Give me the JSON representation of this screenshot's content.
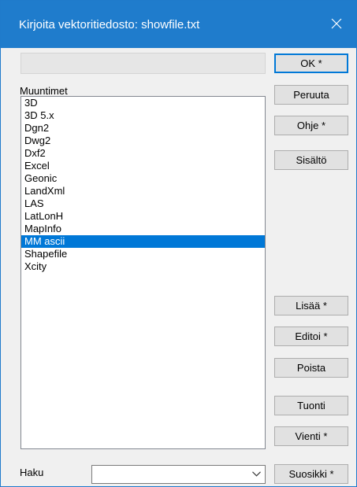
{
  "window": {
    "title": "Kirjoita vektoritiedosto: showfile.txt"
  },
  "file_field": {
    "value": ""
  },
  "converters": {
    "label": "Muuntimet",
    "items": [
      "3D",
      "3D 5.x",
      "Dgn2",
      "Dwg2",
      "Dxf2",
      "Excel",
      "Geonic",
      "LandXml",
      "LAS",
      "LatLonH",
      "MapInfo",
      "MM ascii",
      "Shapefile",
      "Xcity"
    ],
    "selected": "MM ascii"
  },
  "buttons": {
    "ok": "OK *",
    "cancel": "Peruuta",
    "help": "Ohje *",
    "contents": "Sisältö",
    "add": "Lisää *",
    "edit": "Editoi *",
    "delete": "Poista",
    "import": "Tuonti",
    "export": "Vienti *",
    "favorite": "Suosikki *"
  },
  "search": {
    "label": "Haku",
    "value": ""
  },
  "colors": {
    "titlebar": "#1f7ccc",
    "selection": "#0078d7"
  },
  "icons": {
    "close": "close-icon",
    "dropdown": "chevron-down-icon"
  }
}
